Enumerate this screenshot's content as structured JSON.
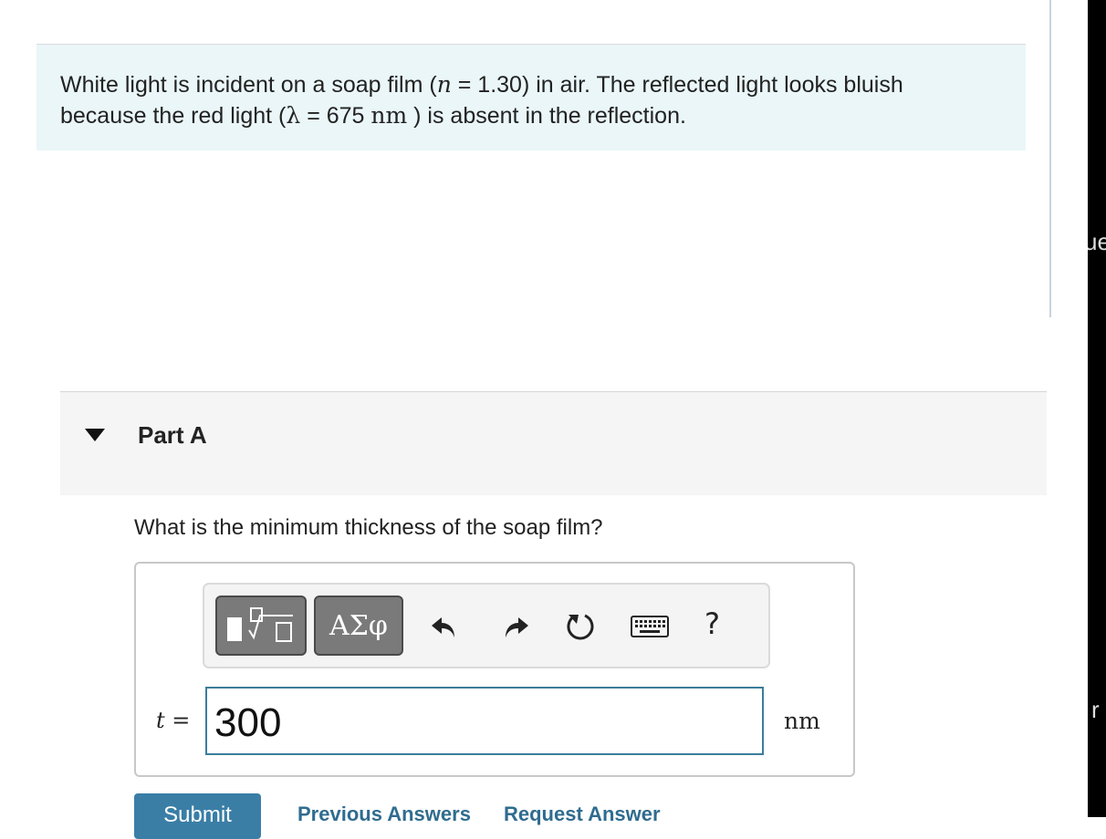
{
  "problem": {
    "line1_a": "White light is incident on a soap film (",
    "n_symbol": "n",
    "line1_b": " = 1.30) in air. The reflected light looks bluish",
    "line2_a": "because the red light (",
    "lambda_symbol": "λ",
    "line2_b": " = 675 ",
    "unit": "nm",
    "line2_c": " ) is absent in the reflection."
  },
  "part": {
    "title": "Part A",
    "question": "What is the minimum thickness of the soap film?"
  },
  "toolbar": {
    "symbols_label": "ΑΣφ",
    "help_label": "?",
    "icons": [
      "templates-icon",
      "undo-icon",
      "redo-icon",
      "reset-icon",
      "keyboard-icon"
    ]
  },
  "answer": {
    "variable": "t =",
    "value": "300",
    "unit": "nm"
  },
  "actions": {
    "submit": "Submit",
    "previous_answers": "Previous Answers",
    "request_answer": "Request Answer"
  },
  "side_fragments": [
    "ue",
    "r"
  ],
  "colors": {
    "problem_bg": "#eaf6f8",
    "part_bg": "#f5f5f5",
    "input_border": "#3a7d9a",
    "submit_bg": "#3a7ea6",
    "link": "#2f6c8f"
  }
}
